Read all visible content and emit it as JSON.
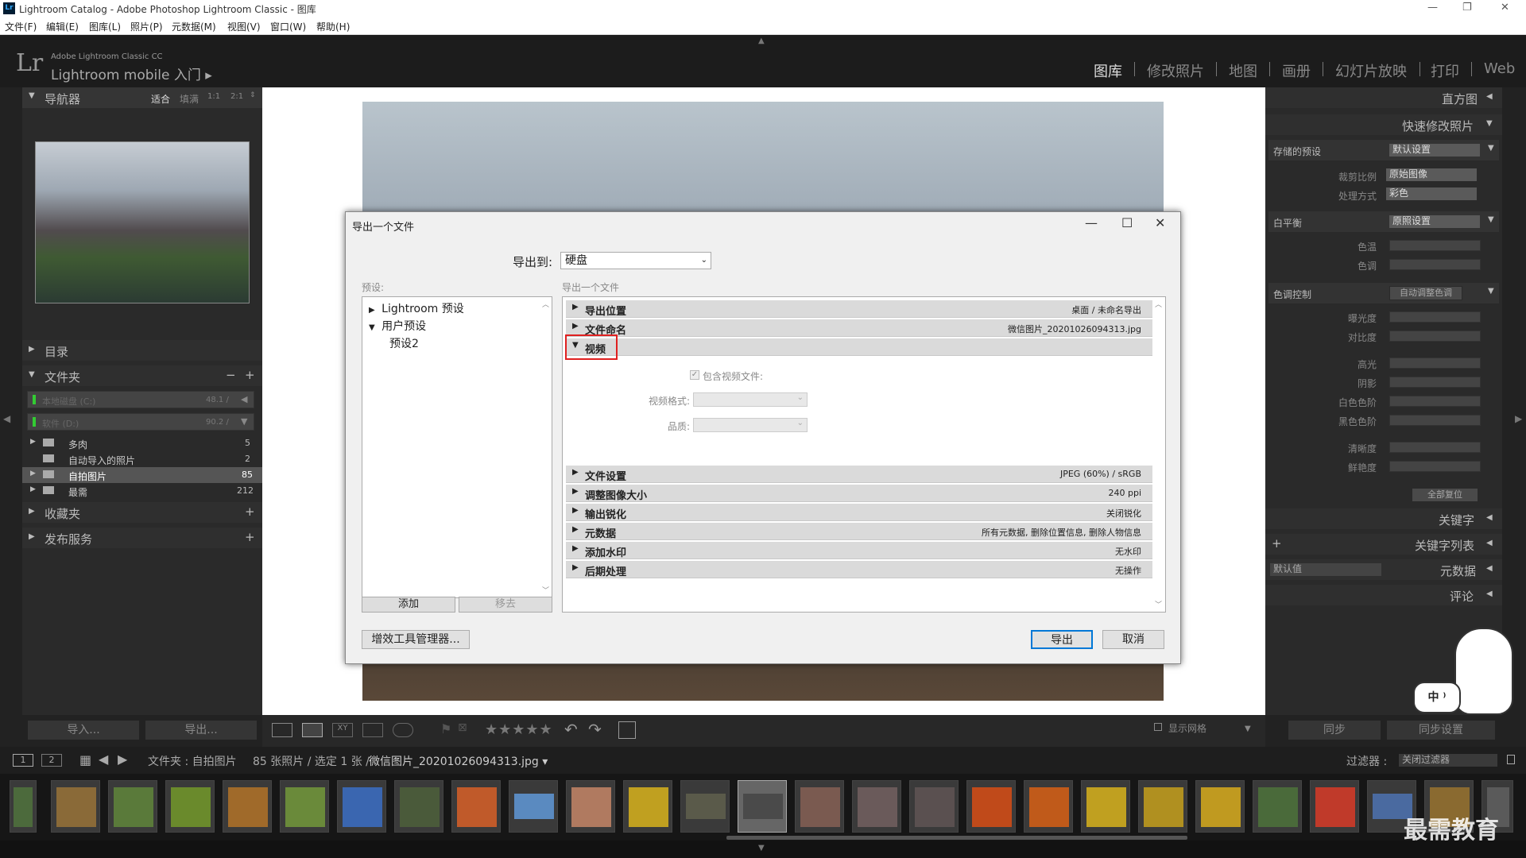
{
  "window": {
    "title": "Lightroom Catalog - Adobe Photoshop Lightroom Classic - 图库",
    "app_icon": "Lr"
  },
  "menu": [
    "文件(F)",
    "编辑(E)",
    "图库(L)",
    "照片(P)",
    "元数据(M)",
    "视图(V)",
    "窗口(W)",
    "帮助(H)"
  ],
  "header": {
    "logo": "Lr",
    "sub1": "Adobe Lightroom Classic CC",
    "sub2": "Lightroom mobile 入门 ▸",
    "modules": [
      "图库",
      "修改照片",
      "地图",
      "画册",
      "幻灯片放映",
      "打印",
      "Web"
    ],
    "active_module": "图库"
  },
  "left": {
    "navigator": {
      "title": "导航器",
      "zoom": [
        "适合",
        "填满",
        "1:1",
        "2:1"
      ]
    },
    "catalog": "目录",
    "folders": {
      "title": "文件夹",
      "volumes": [
        {
          "name": "本地磁盘 (C:)",
          "size": "48.1 /"
        },
        {
          "name": "软件 (D:)",
          "size": "90.2 /"
        }
      ],
      "items": [
        {
          "name": "多肉",
          "count": "5"
        },
        {
          "name": "自动导入的照片",
          "count": "2"
        },
        {
          "name": "自拍图片",
          "count": "85"
        },
        {
          "name": "最需",
          "count": "212"
        }
      ]
    },
    "collections": "收藏夹",
    "publish": "发布服务",
    "import_btn": "导入...",
    "export_btn": "导出..."
  },
  "right": {
    "histogram": "直方图",
    "quick_develop": "快速修改照片",
    "saved_preset": {
      "label": "存储的预设",
      "value": "默认设置"
    },
    "crop": {
      "label": "裁剪比例",
      "value": "原始图像"
    },
    "treatment": {
      "label": "处理方式",
      "value": "彩色"
    },
    "white_balance": {
      "label": "白平衡",
      "value": "原照设置"
    },
    "wb_sliders": [
      "色温",
      "色调"
    ],
    "tone": {
      "label": "色调控制",
      "button": "自动调整色调"
    },
    "tone_sliders": [
      "曝光度",
      "对比度",
      "高光",
      "阴影",
      "白色色阶",
      "黑色色阶",
      "清晰度",
      "鲜艳度"
    ],
    "reset_all": "全部复位",
    "keywording": "关键字",
    "keyword_list": "关键字列表",
    "metadata": {
      "label": "元数据",
      "preset": "默认值"
    },
    "comments": "评论",
    "sync": "同步",
    "sync_settings": "同步设置"
  },
  "toolbar": {
    "show_grid": "显示网格",
    "stars": "★★★★★"
  },
  "filmbar": {
    "pages": [
      "1",
      "2"
    ],
    "path": "文件夹 : 自拍图片",
    "count": "85 张照片 / 选定 1 张 /",
    "file": "微信图片_20201026094313.jpg ▾",
    "filter_label": "过滤器 :",
    "filter_value": "关闭过滤器"
  },
  "dialog": {
    "title": "导出一个文件",
    "export_to_label": "导出到:",
    "export_to_value": "硬盘",
    "presets_label": "预设:",
    "settings_label": "导出一个文件",
    "presets": [
      {
        "tri": "▶",
        "name": "Lightroom 预设"
      },
      {
        "tri": "▼",
        "name": "用户预设"
      },
      {
        "tri": "",
        "name": "预设2"
      }
    ],
    "add": "添加",
    "remove": "移去",
    "sections": [
      {
        "tri": "▶",
        "name": "导出位置",
        "value": "桌面 / 未命名导出"
      },
      {
        "tri": "▶",
        "name": "文件命名",
        "value": "微信图片_20201026094313.jpg"
      },
      {
        "tri": "▼",
        "name": "视频",
        "value": ""
      }
    ],
    "video": {
      "include": "包含视频文件:",
      "format": "视频格式:",
      "quality": "品质:"
    },
    "sections2": [
      {
        "tri": "▶",
        "name": "文件设置",
        "value": "JPEG (60%) / sRGB"
      },
      {
        "tri": "▶",
        "name": "调整图像大小",
        "value": "240 ppi"
      },
      {
        "tri": "▶",
        "name": "输出锐化",
        "value": "关闭锐化"
      },
      {
        "tri": "▶",
        "name": "元数据",
        "value": "所有元数据, 删除位置信息, 删除人物信息"
      },
      {
        "tri": "▶",
        "name": "添加水印",
        "value": "无水印"
      },
      {
        "tri": "▶",
        "name": "后期处理",
        "value": "无操作"
      }
    ],
    "plugin_manager": "增效工具管理器...",
    "export": "导出",
    "cancel": "取消"
  },
  "mascot_text": "中 ⁾",
  "watermark": "最需教育"
}
